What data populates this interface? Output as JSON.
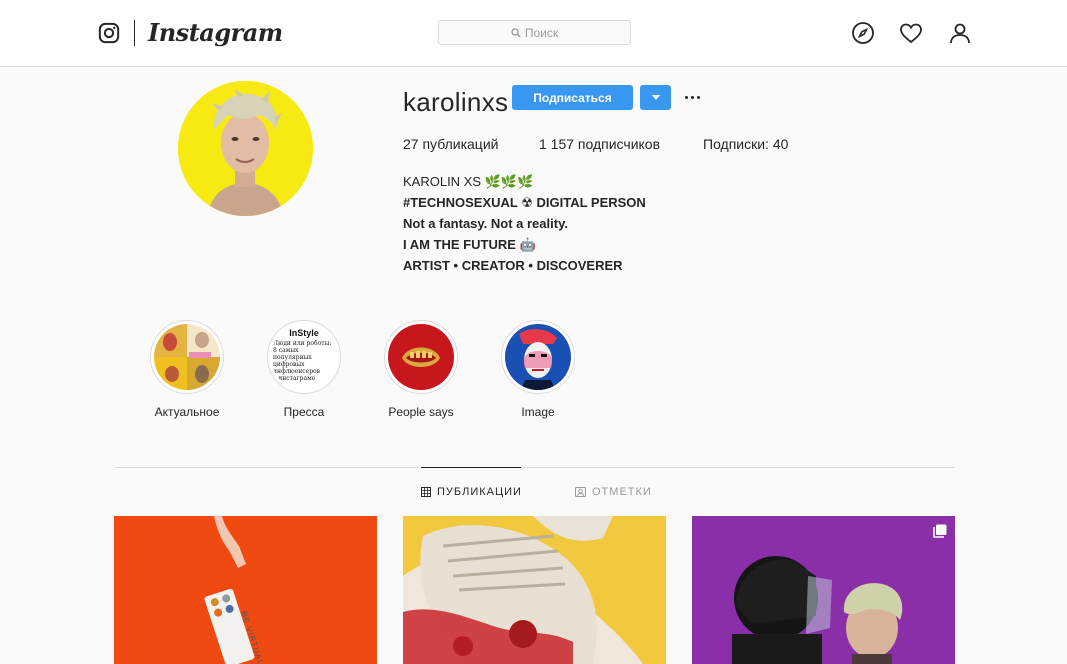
{
  "header": {
    "brand": "Instagram",
    "search_placeholder": "Поиск"
  },
  "profile": {
    "username": "karolinxs",
    "follow_label": "Подписаться",
    "stats": {
      "posts": "27 публикаций",
      "followers": "1 157 подписчиков",
      "following": "Подписки: 40"
    },
    "bio": [
      "KAROLIN XS 🌿🌿🌿",
      "#TECHNOSEXUAL ☢ DIGITAL PERSON",
      "Not a fantasy. Not a reality.",
      "I AM THE FUTURE 🤖",
      "ARTIST • CREATOR • DISCOVERER"
    ]
  },
  "highlights": [
    {
      "label": "Актуальное"
    },
    {
      "label": "Пресса"
    },
    {
      "label": "People says"
    },
    {
      "label": "Image"
    }
  ],
  "highlight_press_text": {
    "brand": "InStyle",
    "lines": [
      "Люди или роботы:",
      "8 самых",
      "популярных",
      "цифровых",
      "инфлюенсеров",
      "в инстаграме"
    ]
  },
  "tabs": {
    "posts": "ПУБЛИКАЦИИ",
    "tagged": "ОТМЕТКИ"
  },
  "posts": [
    {
      "id": "post-1",
      "sticker": "BE VIRTUAL"
    },
    {
      "id": "post-2"
    },
    {
      "id": "post-3"
    }
  ],
  "colors": {
    "accent": "#3897f0",
    "avatar_bg": "#f7ea12",
    "border": "#dbdbdb"
  }
}
